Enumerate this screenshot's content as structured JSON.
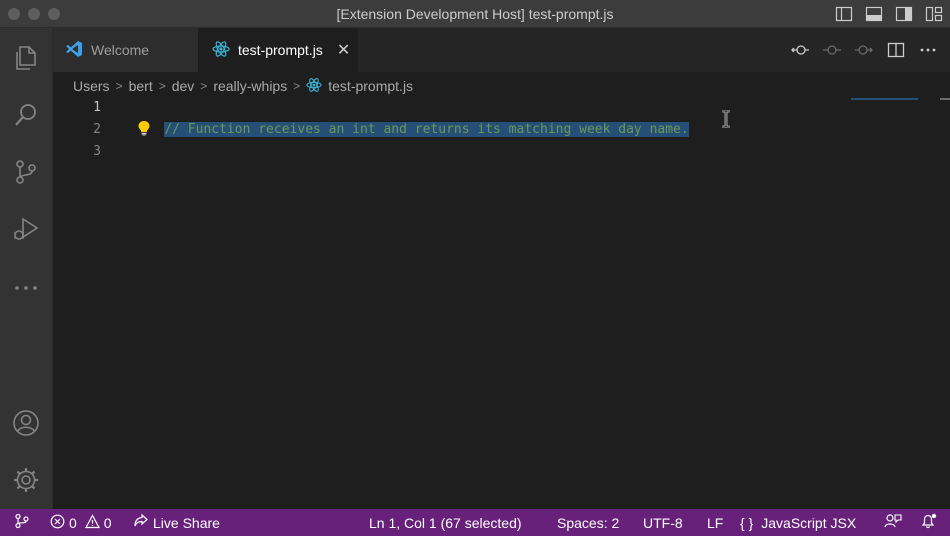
{
  "window": {
    "title": "[Extension Development Host] test-prompt.js"
  },
  "tabs": [
    {
      "label": "Welcome",
      "icon": "vscode-logo-icon",
      "active": false
    },
    {
      "label": "test-prompt.js",
      "icon": "react-icon",
      "active": true
    }
  ],
  "breadcrumb": {
    "parts": [
      "Users",
      "bert",
      "dev",
      "really-whips"
    ],
    "file": "test-prompt.js"
  },
  "editor": {
    "line_numbers": [
      "1",
      "2",
      "3"
    ],
    "lines": [
      "// Function receives an int and returns its matching week day name."
    ]
  },
  "statusbar": {
    "errors": "0",
    "warnings": "0",
    "live_share": "Live Share",
    "position": "Ln 1, Col 1 (67 selected)",
    "spaces": "Spaces: 2",
    "encoding": "UTF-8",
    "eol": "LF",
    "language": "JavaScript JSX"
  },
  "colors": {
    "statusbar": "#68217a",
    "selection": "#264f78",
    "comment": "#6a9955",
    "react": "#3cb0d4",
    "vscode": "#3ca0e8"
  }
}
